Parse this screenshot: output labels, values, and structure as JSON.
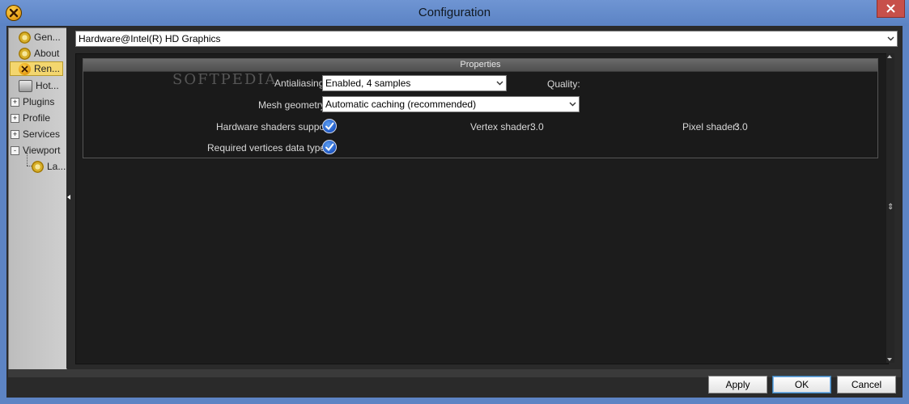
{
  "window": {
    "title": "Configuration"
  },
  "sidebar": {
    "items": [
      {
        "label": "Gen...",
        "icon": "gear-icon"
      },
      {
        "label": "About",
        "icon": "gear-icon"
      },
      {
        "label": "Ren...",
        "icon": "render-icon",
        "selected": true
      },
      {
        "label": "Hot...",
        "icon": "keyboard-icon"
      },
      {
        "label": "Plugins",
        "expander": "+"
      },
      {
        "label": "Profile",
        "expander": "+"
      },
      {
        "label": "Services",
        "expander": "+"
      },
      {
        "label": "Viewport",
        "expander": "-"
      },
      {
        "label": "La...",
        "icon": "gear-icon"
      }
    ]
  },
  "device": {
    "selected": "Hardware@Intel(R) HD Graphics"
  },
  "properties": {
    "header": "Properties",
    "antialiasing_label": "Antialiasing:",
    "antialiasing_value": "Enabled, 4 samples",
    "quality_label": "Quality:",
    "mesh_label": "Mesh geometry:",
    "mesh_value": "Automatic caching (recommended)",
    "hw_shaders_label": "Hardware shaders support:",
    "vertex_shader_label": "Vertex shader:",
    "vertex_shader_value": "3.0",
    "pixel_shader_label": "Pixel shader:",
    "pixel_shader_value": "3.0",
    "vertices_label": "Required vertices data types:"
  },
  "watermark": "SOFTPEDIA",
  "buttons": {
    "apply": "Apply",
    "ok": "OK",
    "cancel": "Cancel"
  },
  "colors": {
    "title_bar": "#5d84c4",
    "selected_item": "#f3d66e",
    "close_button": "#c7504a"
  }
}
